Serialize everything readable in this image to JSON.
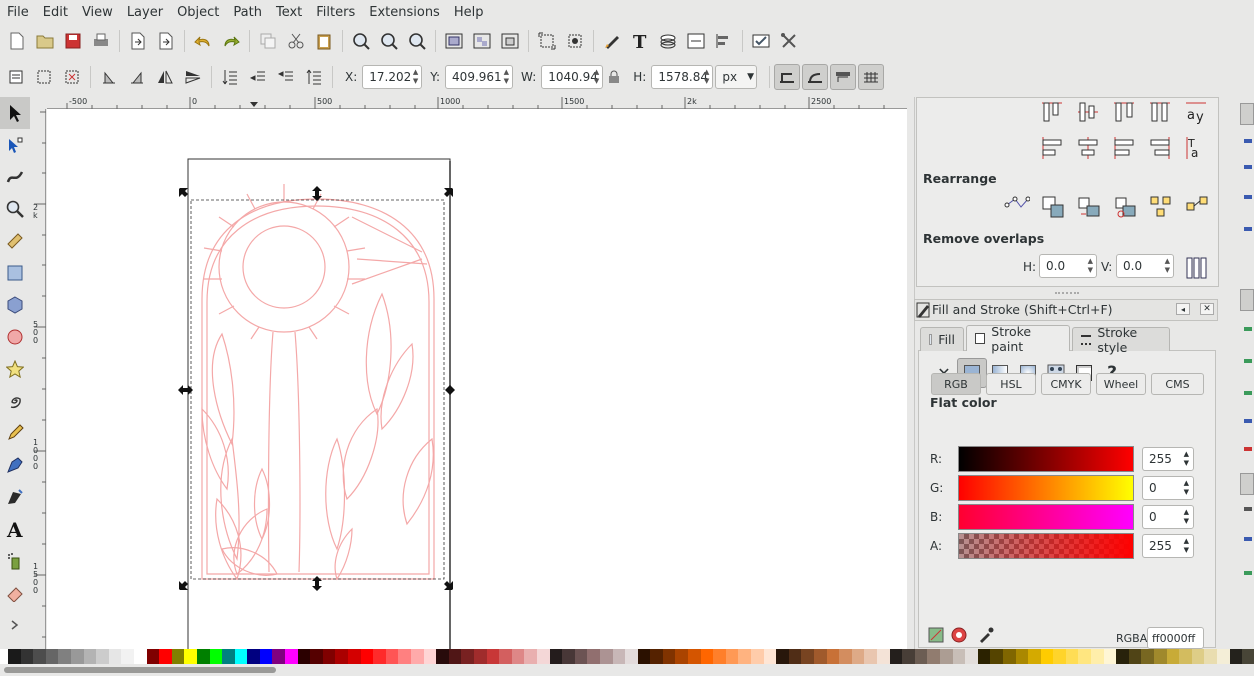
{
  "menu": [
    "File",
    "Edit",
    "View",
    "Layer",
    "Object",
    "Path",
    "Text",
    "Filters",
    "Extensions",
    "Help"
  ],
  "toolbar": {
    "x_label": "X:",
    "x_value": "17.202",
    "y_label": "Y:",
    "y_value": "409.961",
    "w_label": "W:",
    "w_value": "1040.94",
    "h_label": "H:",
    "h_value": "1578.84",
    "unit": "px"
  },
  "ruler": {
    "h_ticks": [
      "-500",
      "0",
      "500",
      "1000",
      "1500",
      "2k",
      "2500"
    ],
    "v_ticks": [
      "0",
      "2k",
      "500",
      "1000",
      "1500"
    ]
  },
  "align_panel": {
    "rearrange_label": "Rearrange",
    "remove_overlaps_label": "Remove overlaps",
    "h_label": "H:",
    "h_value": "0.0",
    "v_label": "V:",
    "v_value": "0.0"
  },
  "fill_stroke": {
    "title": "Fill and Stroke (Shift+Ctrl+F)",
    "tabs": [
      "Fill",
      "Stroke paint",
      "Stroke style"
    ],
    "active_tab": "Stroke paint",
    "flat_color_label": "Flat color",
    "modes": [
      "RGB",
      "HSL",
      "CMYK",
      "Wheel",
      "CMS"
    ],
    "active_mode": "RGB",
    "channels": [
      {
        "label": "R:",
        "value": "255"
      },
      {
        "label": "G:",
        "value": "0"
      },
      {
        "label": "B:",
        "value": "0"
      },
      {
        "label": "A:",
        "value": "255"
      }
    ],
    "rgba_label": "RGBA:",
    "rgba_value": "ff0000ff"
  },
  "colors": {
    "stroke": "#ff0000",
    "artwork_line": "#f4a8a8",
    "selection_handle": "#000000"
  }
}
